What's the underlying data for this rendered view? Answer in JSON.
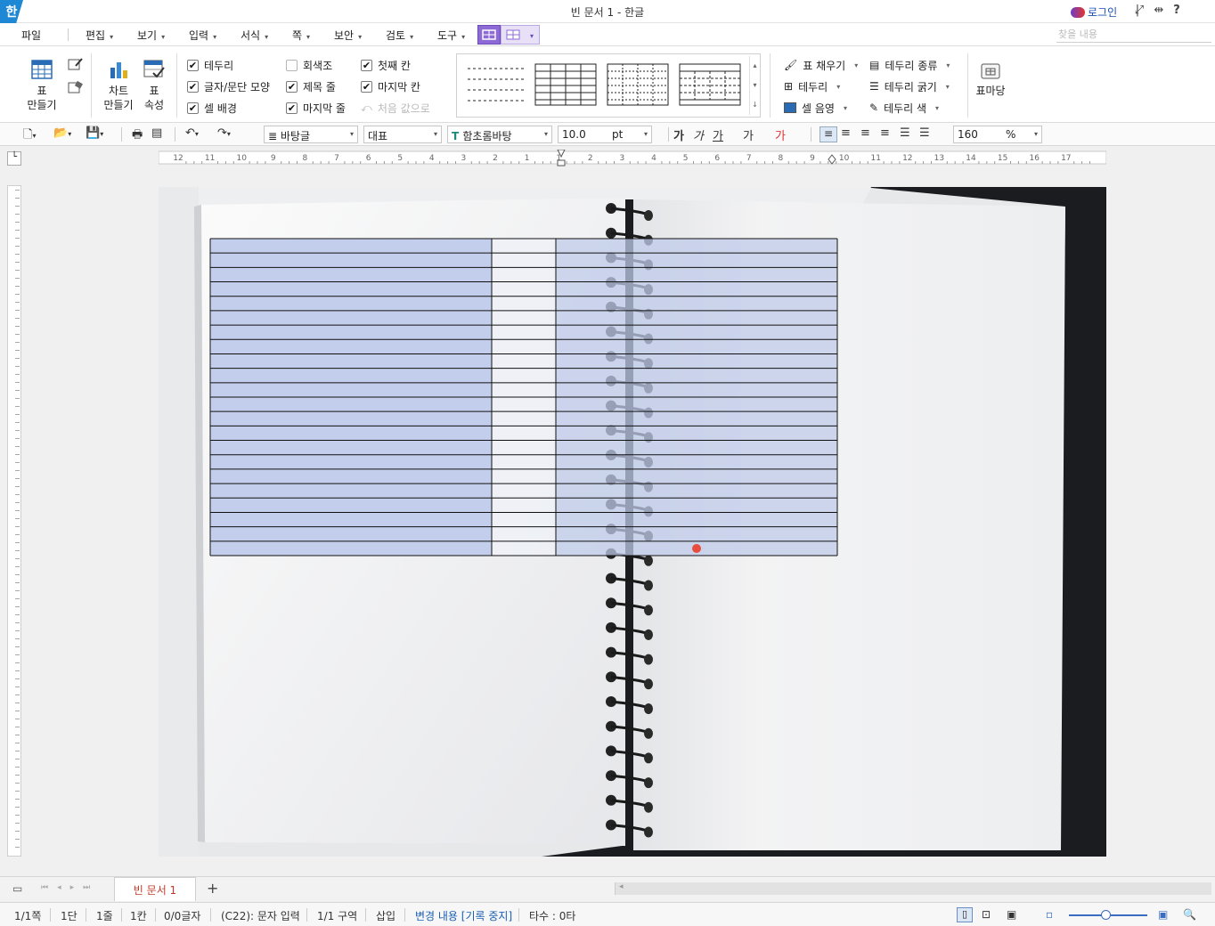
{
  "window": {
    "app_logo": "한",
    "title": "빈 문서 1 - 한글",
    "login_label": "로그인",
    "help_label": "?"
  },
  "menus": [
    "파일",
    "편집",
    "보기",
    "입력",
    "서식",
    "쪽",
    "보안",
    "검토",
    "도구"
  ],
  "find": {
    "placeholder": "찾을 내용"
  },
  "ribbon": {
    "table_make": "표\n만들기",
    "chart_make": "차트\n만들기",
    "table_props": "표\n속성",
    "checks": [
      {
        "label": "테두리",
        "checked": true
      },
      {
        "label": "글자/문단 모양",
        "checked": true
      },
      {
        "label": "셀 배경",
        "checked": true
      },
      {
        "label": "회색조",
        "checked": false
      },
      {
        "label": "제목 줄",
        "checked": true
      },
      {
        "label": "마지막 줄",
        "checked": true
      },
      {
        "label": "첫째 칸",
        "checked": true
      },
      {
        "label": "마지막 칸",
        "checked": true
      }
    ],
    "reset_label": "처음 값으로",
    "fill_label": "표 채우기",
    "border_label": "테두리",
    "cell_shade_label": "셀 음영",
    "border_type_label": "테두리 종류",
    "border_width_label": "테두리 굵기",
    "border_color_label": "테두리 색",
    "table_yard_label": "표마당"
  },
  "toolbar": {
    "style": "바탕글",
    "lang": "대표",
    "font": "함초롬바탕",
    "size": "10.0",
    "unit": "pt",
    "fmt": [
      "가",
      "가",
      "가",
      "가",
      "가"
    ],
    "zoom": "160",
    "zoom_unit": "%"
  },
  "hruler": [
    "12",
    "11",
    "10",
    "9",
    "8",
    "7",
    "6",
    "5",
    "4",
    "3",
    "2",
    "1",
    "1",
    "2",
    "3",
    "4",
    "5",
    "6",
    "7",
    "8",
    "9",
    "10",
    "11",
    "12",
    "13",
    "14",
    "15",
    "16",
    "17"
  ],
  "tabs": {
    "doc": "빈 문서 1",
    "add": "+"
  },
  "status": {
    "page": "1/1쪽",
    "column": "1단",
    "line": "1줄",
    "col": "1칸",
    "chars": "0/0글자",
    "cell": "(C22): 문자 입력",
    "section": "1/1 구역",
    "mode": "삽입",
    "track": "변경 내용 [기록 중지]",
    "typing": "타수 : 0타"
  },
  "table": {
    "rows": 22,
    "cols": 3
  }
}
